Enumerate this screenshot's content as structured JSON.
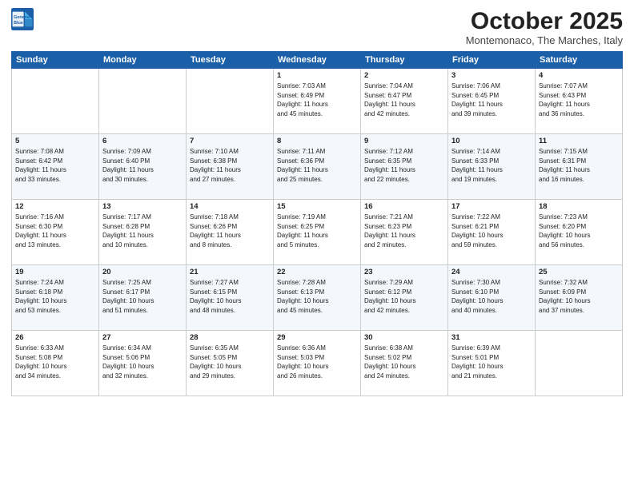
{
  "logo": {
    "line1": "General",
    "line2": "Blue"
  },
  "title": "October 2025",
  "subtitle": "Montemonaco, The Marches, Italy",
  "days_header": [
    "Sunday",
    "Monday",
    "Tuesday",
    "Wednesday",
    "Thursday",
    "Friday",
    "Saturday"
  ],
  "weeks": [
    [
      {
        "num": "",
        "info": ""
      },
      {
        "num": "",
        "info": ""
      },
      {
        "num": "",
        "info": ""
      },
      {
        "num": "1",
        "info": "Sunrise: 7:03 AM\nSunset: 6:49 PM\nDaylight: 11 hours\nand 45 minutes."
      },
      {
        "num": "2",
        "info": "Sunrise: 7:04 AM\nSunset: 6:47 PM\nDaylight: 11 hours\nand 42 minutes."
      },
      {
        "num": "3",
        "info": "Sunrise: 7:06 AM\nSunset: 6:45 PM\nDaylight: 11 hours\nand 39 minutes."
      },
      {
        "num": "4",
        "info": "Sunrise: 7:07 AM\nSunset: 6:43 PM\nDaylight: 11 hours\nand 36 minutes."
      }
    ],
    [
      {
        "num": "5",
        "info": "Sunrise: 7:08 AM\nSunset: 6:42 PM\nDaylight: 11 hours\nand 33 minutes."
      },
      {
        "num": "6",
        "info": "Sunrise: 7:09 AM\nSunset: 6:40 PM\nDaylight: 11 hours\nand 30 minutes."
      },
      {
        "num": "7",
        "info": "Sunrise: 7:10 AM\nSunset: 6:38 PM\nDaylight: 11 hours\nand 27 minutes."
      },
      {
        "num": "8",
        "info": "Sunrise: 7:11 AM\nSunset: 6:36 PM\nDaylight: 11 hours\nand 25 minutes."
      },
      {
        "num": "9",
        "info": "Sunrise: 7:12 AM\nSunset: 6:35 PM\nDaylight: 11 hours\nand 22 minutes."
      },
      {
        "num": "10",
        "info": "Sunrise: 7:14 AM\nSunset: 6:33 PM\nDaylight: 11 hours\nand 19 minutes."
      },
      {
        "num": "11",
        "info": "Sunrise: 7:15 AM\nSunset: 6:31 PM\nDaylight: 11 hours\nand 16 minutes."
      }
    ],
    [
      {
        "num": "12",
        "info": "Sunrise: 7:16 AM\nSunset: 6:30 PM\nDaylight: 11 hours\nand 13 minutes."
      },
      {
        "num": "13",
        "info": "Sunrise: 7:17 AM\nSunset: 6:28 PM\nDaylight: 11 hours\nand 10 minutes."
      },
      {
        "num": "14",
        "info": "Sunrise: 7:18 AM\nSunset: 6:26 PM\nDaylight: 11 hours\nand 8 minutes."
      },
      {
        "num": "15",
        "info": "Sunrise: 7:19 AM\nSunset: 6:25 PM\nDaylight: 11 hours\nand 5 minutes."
      },
      {
        "num": "16",
        "info": "Sunrise: 7:21 AM\nSunset: 6:23 PM\nDaylight: 11 hours\nand 2 minutes."
      },
      {
        "num": "17",
        "info": "Sunrise: 7:22 AM\nSunset: 6:21 PM\nDaylight: 10 hours\nand 59 minutes."
      },
      {
        "num": "18",
        "info": "Sunrise: 7:23 AM\nSunset: 6:20 PM\nDaylight: 10 hours\nand 56 minutes."
      }
    ],
    [
      {
        "num": "19",
        "info": "Sunrise: 7:24 AM\nSunset: 6:18 PM\nDaylight: 10 hours\nand 53 minutes."
      },
      {
        "num": "20",
        "info": "Sunrise: 7:25 AM\nSunset: 6:17 PM\nDaylight: 10 hours\nand 51 minutes."
      },
      {
        "num": "21",
        "info": "Sunrise: 7:27 AM\nSunset: 6:15 PM\nDaylight: 10 hours\nand 48 minutes."
      },
      {
        "num": "22",
        "info": "Sunrise: 7:28 AM\nSunset: 6:13 PM\nDaylight: 10 hours\nand 45 minutes."
      },
      {
        "num": "23",
        "info": "Sunrise: 7:29 AM\nSunset: 6:12 PM\nDaylight: 10 hours\nand 42 minutes."
      },
      {
        "num": "24",
        "info": "Sunrise: 7:30 AM\nSunset: 6:10 PM\nDaylight: 10 hours\nand 40 minutes."
      },
      {
        "num": "25",
        "info": "Sunrise: 7:32 AM\nSunset: 6:09 PM\nDaylight: 10 hours\nand 37 minutes."
      }
    ],
    [
      {
        "num": "26",
        "info": "Sunrise: 6:33 AM\nSunset: 5:08 PM\nDaylight: 10 hours\nand 34 minutes."
      },
      {
        "num": "27",
        "info": "Sunrise: 6:34 AM\nSunset: 5:06 PM\nDaylight: 10 hours\nand 32 minutes."
      },
      {
        "num": "28",
        "info": "Sunrise: 6:35 AM\nSunset: 5:05 PM\nDaylight: 10 hours\nand 29 minutes."
      },
      {
        "num": "29",
        "info": "Sunrise: 6:36 AM\nSunset: 5:03 PM\nDaylight: 10 hours\nand 26 minutes."
      },
      {
        "num": "30",
        "info": "Sunrise: 6:38 AM\nSunset: 5:02 PM\nDaylight: 10 hours\nand 24 minutes."
      },
      {
        "num": "31",
        "info": "Sunrise: 6:39 AM\nSunset: 5:01 PM\nDaylight: 10 hours\nand 21 minutes."
      },
      {
        "num": "",
        "info": ""
      }
    ]
  ]
}
